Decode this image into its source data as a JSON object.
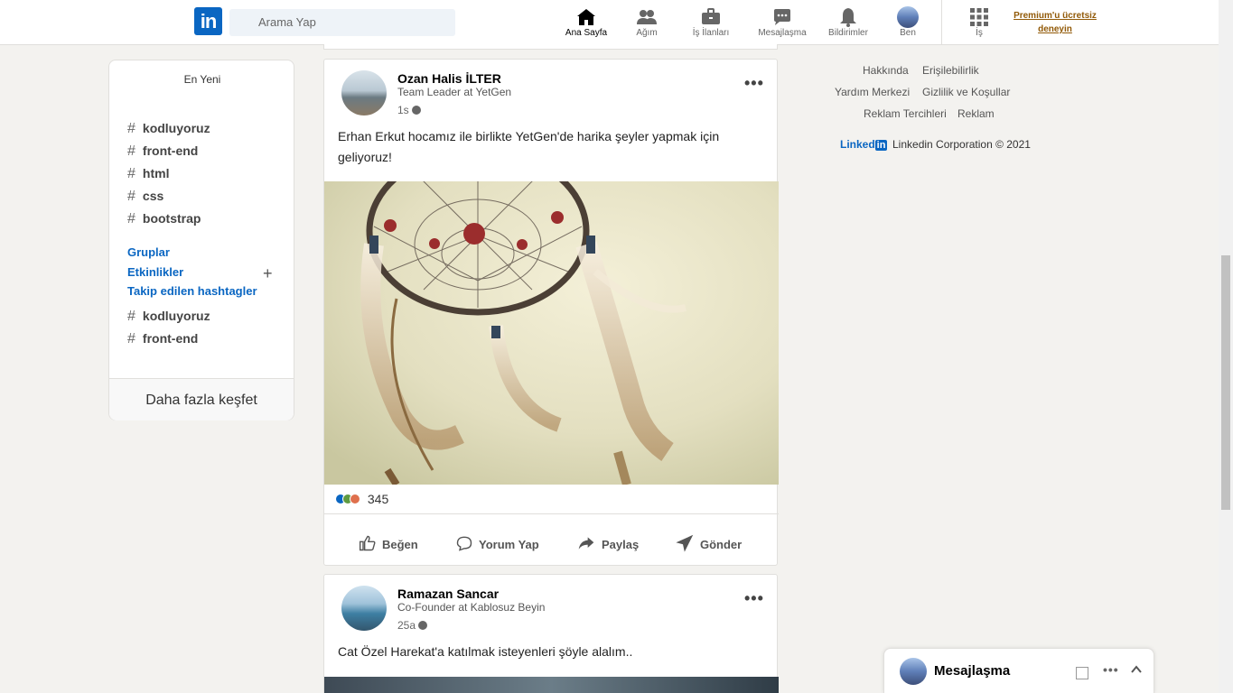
{
  "nav": {
    "logo": "in",
    "search_placeholder": "Arama Yap",
    "items": [
      {
        "label": "Ana Sayfa",
        "icon": "home-icon"
      },
      {
        "label": "Ağım",
        "icon": "network-icon"
      },
      {
        "label": "İş İlanları",
        "icon": "briefcase-icon"
      },
      {
        "label": "Mesajlaşma",
        "icon": "chat-icon"
      },
      {
        "label": "Bildirimler",
        "icon": "bell-icon"
      },
      {
        "label": "Ben",
        "icon": "avatar"
      },
      {
        "label": "İş",
        "icon": "grid-icon"
      }
    ],
    "premium": "Premium'u ücretsiz deneyin"
  },
  "left": {
    "title": "En Yeni",
    "recent_tags": [
      "kodluyoruz",
      "front-end",
      "html",
      "css",
      "bootstrap"
    ],
    "links": {
      "groups": "Gruplar",
      "events": "Etkinlikler",
      "followed": "Takip edilen hashtagler"
    },
    "followed_tags": [
      "kodluyoruz",
      "front-end"
    ],
    "discover": "Daha fazla keşfet"
  },
  "posts": [
    {
      "name": "Ozan Halis İLTER",
      "subtitle": "Team Leader at YetGen",
      "time": "1s",
      "text": "Erhan Erkut hocamız ile birlikte YetGen'de harika şeyler yapmak için geliyoruz!",
      "reaction_count": "345",
      "actions": {
        "like": "Beğen",
        "comment": "Yorum Yap",
        "share": "Paylaş",
        "send": "Gönder"
      }
    },
    {
      "name": "Ramazan Sancar",
      "subtitle": "Co-Founder at Kablosuz Beyin",
      "time": "25a",
      "text": "Cat Özel Harekat'a katılmak isteyenleri şöyle alalım.."
    }
  ],
  "right": {
    "links": [
      "Hakkında",
      "Erişilebilirlik",
      "Yardım Merkezi",
      "Gizlilik ve Koşullar",
      "Reklam Tercihleri",
      "Reklam"
    ],
    "brand": "Linked",
    "brand_in": "in",
    "copyright": "Linkedin Corporation © 2021"
  },
  "messaging": {
    "title": "Mesajlaşma"
  }
}
